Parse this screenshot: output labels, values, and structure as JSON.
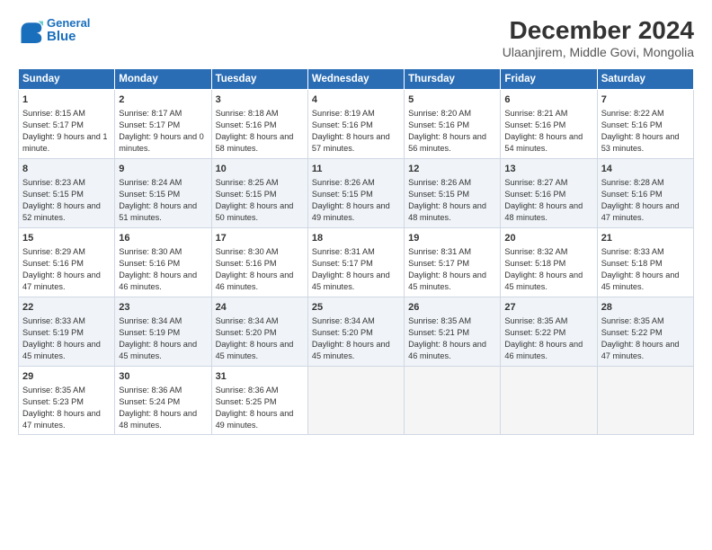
{
  "header": {
    "logo_line1": "General",
    "logo_line2": "Blue",
    "title": "December 2024",
    "subtitle": "Ulaanjirem, Middle Govi, Mongolia"
  },
  "columns": [
    "Sunday",
    "Monday",
    "Tuesday",
    "Wednesday",
    "Thursday",
    "Friday",
    "Saturday"
  ],
  "weeks": [
    [
      {
        "day": "1",
        "lines": [
          "Sunrise: 8:15 AM",
          "Sunset: 5:17 PM",
          "Daylight: 9 hours",
          "and 1 minute."
        ]
      },
      {
        "day": "2",
        "lines": [
          "Sunrise: 8:17 AM",
          "Sunset: 5:17 PM",
          "Daylight: 9 hours",
          "and 0 minutes."
        ]
      },
      {
        "day": "3",
        "lines": [
          "Sunrise: 8:18 AM",
          "Sunset: 5:16 PM",
          "Daylight: 8 hours",
          "and 58 minutes."
        ]
      },
      {
        "day": "4",
        "lines": [
          "Sunrise: 8:19 AM",
          "Sunset: 5:16 PM",
          "Daylight: 8 hours",
          "and 57 minutes."
        ]
      },
      {
        "day": "5",
        "lines": [
          "Sunrise: 8:20 AM",
          "Sunset: 5:16 PM",
          "Daylight: 8 hours",
          "and 56 minutes."
        ]
      },
      {
        "day": "6",
        "lines": [
          "Sunrise: 8:21 AM",
          "Sunset: 5:16 PM",
          "Daylight: 8 hours",
          "and 54 minutes."
        ]
      },
      {
        "day": "7",
        "lines": [
          "Sunrise: 8:22 AM",
          "Sunset: 5:16 PM",
          "Daylight: 8 hours",
          "and 53 minutes."
        ]
      }
    ],
    [
      {
        "day": "8",
        "lines": [
          "Sunrise: 8:23 AM",
          "Sunset: 5:15 PM",
          "Daylight: 8 hours",
          "and 52 minutes."
        ]
      },
      {
        "day": "9",
        "lines": [
          "Sunrise: 8:24 AM",
          "Sunset: 5:15 PM",
          "Daylight: 8 hours",
          "and 51 minutes."
        ]
      },
      {
        "day": "10",
        "lines": [
          "Sunrise: 8:25 AM",
          "Sunset: 5:15 PM",
          "Daylight: 8 hours",
          "and 50 minutes."
        ]
      },
      {
        "day": "11",
        "lines": [
          "Sunrise: 8:26 AM",
          "Sunset: 5:15 PM",
          "Daylight: 8 hours",
          "and 49 minutes."
        ]
      },
      {
        "day": "12",
        "lines": [
          "Sunrise: 8:26 AM",
          "Sunset: 5:15 PM",
          "Daylight: 8 hours",
          "and 48 minutes."
        ]
      },
      {
        "day": "13",
        "lines": [
          "Sunrise: 8:27 AM",
          "Sunset: 5:16 PM",
          "Daylight: 8 hours",
          "and 48 minutes."
        ]
      },
      {
        "day": "14",
        "lines": [
          "Sunrise: 8:28 AM",
          "Sunset: 5:16 PM",
          "Daylight: 8 hours",
          "and 47 minutes."
        ]
      }
    ],
    [
      {
        "day": "15",
        "lines": [
          "Sunrise: 8:29 AM",
          "Sunset: 5:16 PM",
          "Daylight: 8 hours",
          "and 47 minutes."
        ]
      },
      {
        "day": "16",
        "lines": [
          "Sunrise: 8:30 AM",
          "Sunset: 5:16 PM",
          "Daylight: 8 hours",
          "and 46 minutes."
        ]
      },
      {
        "day": "17",
        "lines": [
          "Sunrise: 8:30 AM",
          "Sunset: 5:16 PM",
          "Daylight: 8 hours",
          "and 46 minutes."
        ]
      },
      {
        "day": "18",
        "lines": [
          "Sunrise: 8:31 AM",
          "Sunset: 5:17 PM",
          "Daylight: 8 hours",
          "and 45 minutes."
        ]
      },
      {
        "day": "19",
        "lines": [
          "Sunrise: 8:31 AM",
          "Sunset: 5:17 PM",
          "Daylight: 8 hours",
          "and 45 minutes."
        ]
      },
      {
        "day": "20",
        "lines": [
          "Sunrise: 8:32 AM",
          "Sunset: 5:18 PM",
          "Daylight: 8 hours",
          "and 45 minutes."
        ]
      },
      {
        "day": "21",
        "lines": [
          "Sunrise: 8:33 AM",
          "Sunset: 5:18 PM",
          "Daylight: 8 hours",
          "and 45 minutes."
        ]
      }
    ],
    [
      {
        "day": "22",
        "lines": [
          "Sunrise: 8:33 AM",
          "Sunset: 5:19 PM",
          "Daylight: 8 hours",
          "and 45 minutes."
        ]
      },
      {
        "day": "23",
        "lines": [
          "Sunrise: 8:34 AM",
          "Sunset: 5:19 PM",
          "Daylight: 8 hours",
          "and 45 minutes."
        ]
      },
      {
        "day": "24",
        "lines": [
          "Sunrise: 8:34 AM",
          "Sunset: 5:20 PM",
          "Daylight: 8 hours",
          "and 45 minutes."
        ]
      },
      {
        "day": "25",
        "lines": [
          "Sunrise: 8:34 AM",
          "Sunset: 5:20 PM",
          "Daylight: 8 hours",
          "and 45 minutes."
        ]
      },
      {
        "day": "26",
        "lines": [
          "Sunrise: 8:35 AM",
          "Sunset: 5:21 PM",
          "Daylight: 8 hours",
          "and 46 minutes."
        ]
      },
      {
        "day": "27",
        "lines": [
          "Sunrise: 8:35 AM",
          "Sunset: 5:22 PM",
          "Daylight: 8 hours",
          "and 46 minutes."
        ]
      },
      {
        "day": "28",
        "lines": [
          "Sunrise: 8:35 AM",
          "Sunset: 5:22 PM",
          "Daylight: 8 hours",
          "and 47 minutes."
        ]
      }
    ],
    [
      {
        "day": "29",
        "lines": [
          "Sunrise: 8:35 AM",
          "Sunset: 5:23 PM",
          "Daylight: 8 hours",
          "and 47 minutes."
        ]
      },
      {
        "day": "30",
        "lines": [
          "Sunrise: 8:36 AM",
          "Sunset: 5:24 PM",
          "Daylight: 8 hours",
          "and 48 minutes."
        ]
      },
      {
        "day": "31",
        "lines": [
          "Sunrise: 8:36 AM",
          "Sunset: 5:25 PM",
          "Daylight: 8 hours",
          "and 49 minutes."
        ]
      },
      null,
      null,
      null,
      null
    ]
  ]
}
